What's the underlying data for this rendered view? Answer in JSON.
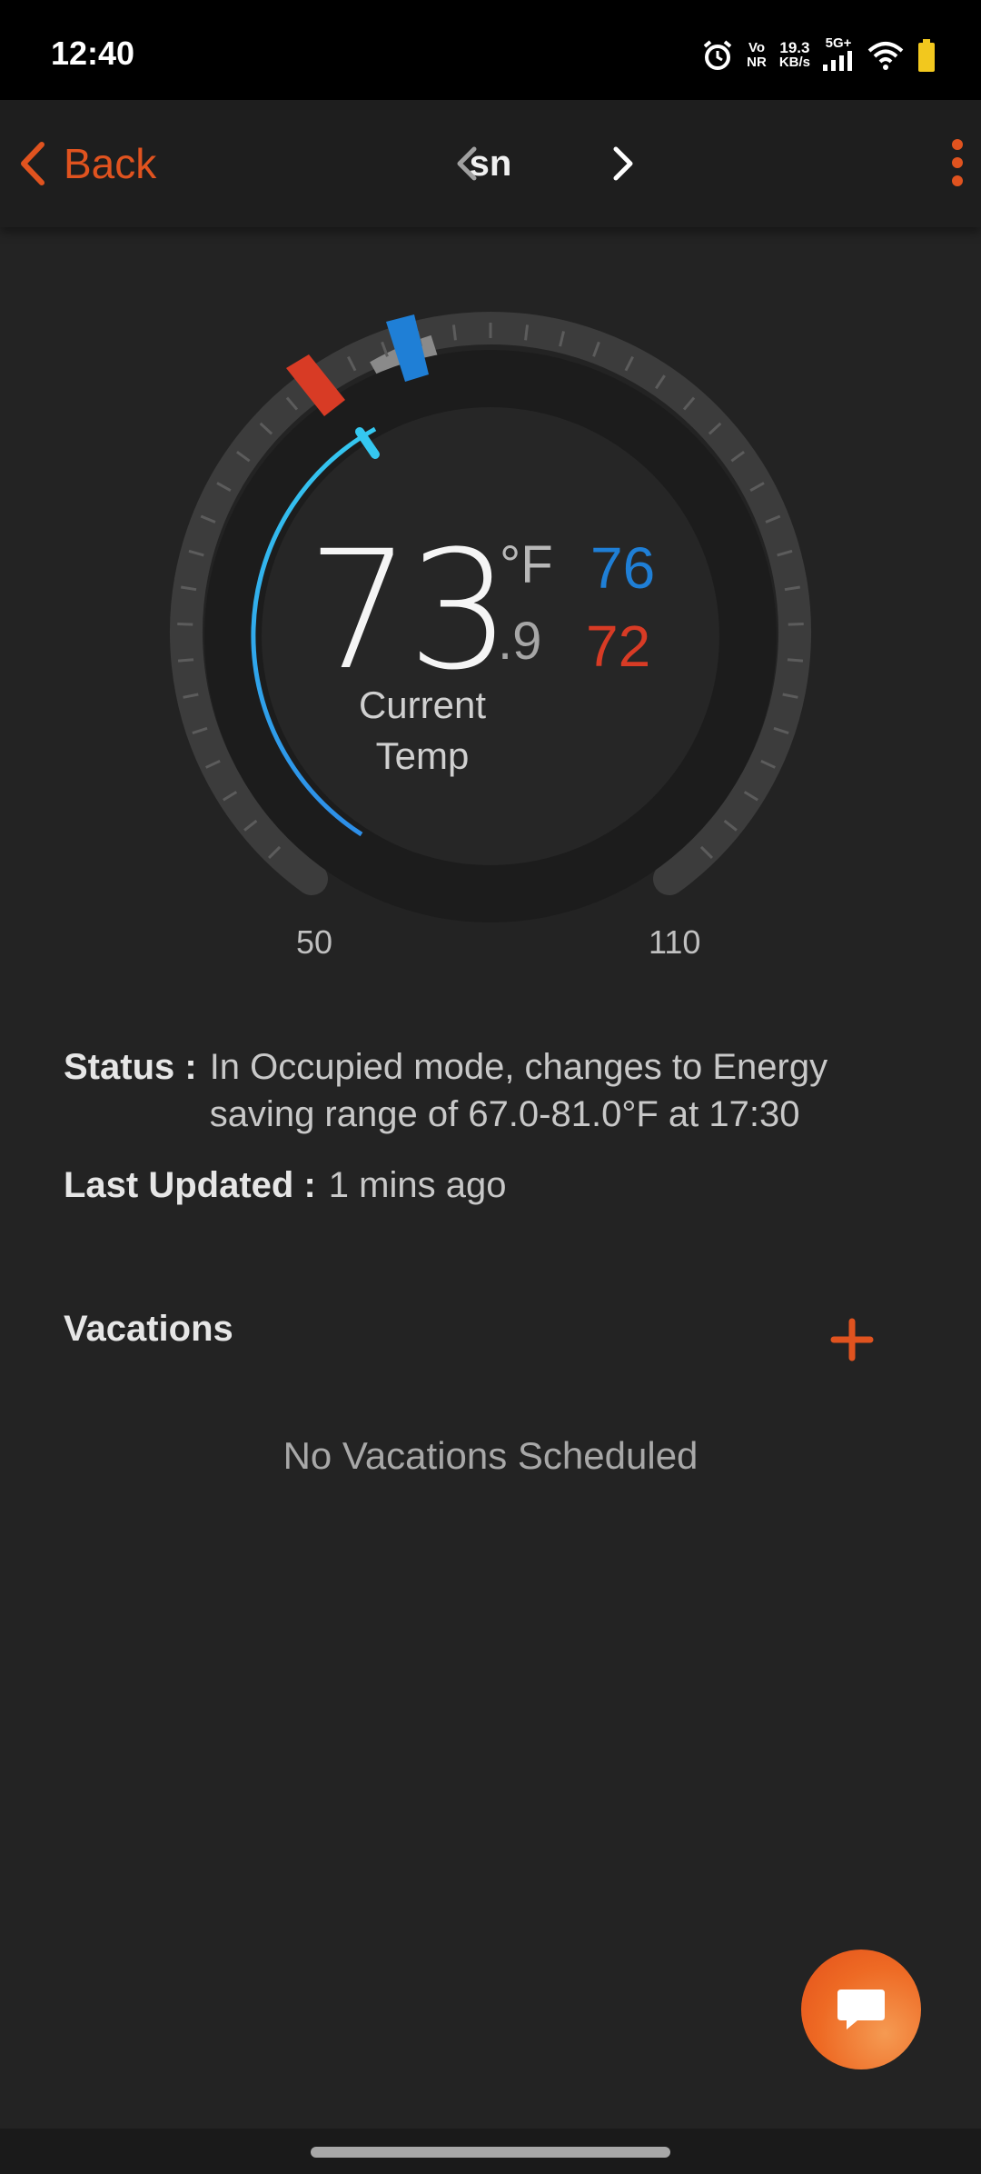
{
  "status_bar": {
    "time": "12:40",
    "network_top": "Vo",
    "network_bottom": "NR",
    "speed_value": "19.3",
    "speed_unit": "KB/s",
    "signal_label": "5G+",
    "icons": [
      "alarm-icon",
      "signal-icon",
      "wifi-icon",
      "battery-icon"
    ]
  },
  "header": {
    "back_label": "Back",
    "title": "sn",
    "accent_color": "#e0531f"
  },
  "thermostat": {
    "current_temp_whole": "73",
    "current_temp_decimal": ".9",
    "unit": "°F",
    "cool_setpoint": "76",
    "heat_setpoint": "72",
    "label_line1": "Current",
    "label_line2": "Temp",
    "scale_min": "50",
    "scale_max": "110",
    "cool_color": "#1f7fd6",
    "heat_color": "#d83b25"
  },
  "info": {
    "status_label": "Status :",
    "status_value": "In Occupied mode, changes to Energy saving range of 67.0-81.0°F at 17:30",
    "updated_label": "Last Updated :",
    "updated_value": "1 mins ago"
  },
  "vacations": {
    "title": "Vacations",
    "empty_text": "No Vacations Scheduled"
  }
}
